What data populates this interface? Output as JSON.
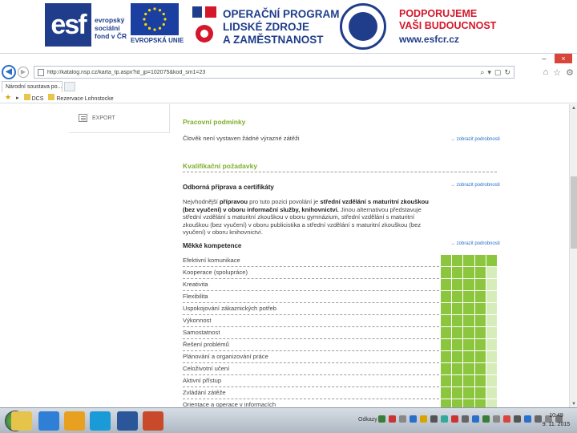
{
  "banner": {
    "esf_letters": "esf",
    "esf_text": "evropský\nsociální\nfond v ČR",
    "eu_caption": "EVROPSKÁ UNIE",
    "op_text": "OPERAČNÍ PROGRAM\nLIDSKÉ ZDROJE\nA ZAMĚSTNANOST",
    "support_text": "PODPORUJEME\nVAŠI BUDOUCNOST",
    "support_url": "www.esfcr.cz"
  },
  "browser": {
    "minimize": "–",
    "close": "×",
    "url": "http://katalog.nsp.cz/karta_tp.aspx?id_jp=102075&kod_sm1=23",
    "tab_label": "Národní soustava po...",
    "favorites": [
      "DCS",
      "Rezervace Lohnstocke"
    ]
  },
  "page": {
    "export_label": "EXPORT",
    "working_conditions": {
      "title": "Pracovní podmínky",
      "text": "Člověk není vystaven žádné výrazné zátěži",
      "link": "zobrazit podrobnosti"
    },
    "qualification_title": "Kvalifikační požadavky",
    "education": {
      "title": "Odborná příprava a certifikáty",
      "text_before": "Nejvhodnější ",
      "text_bold1": "přípravou",
      "text_mid1": " pro tuto pozici povolání je ",
      "text_bold2": "střední vzdělání s maturitní zkouškou (bez vyučení) v oboru informační služby, knihovnictví.",
      "text_after": " Jinou alternativou představuje střední vzdělání s maturitní zkouškou v oboru gymnázium, střední vzdělání s maturitní zkouškou (bez vyučení) v oboru publicistika a střední vzdělání s maturitní zkouškou (bez vyučení) v oboru knihovnictví.",
      "link": "zobrazit podrobnosti"
    },
    "soft_skills": {
      "title": "Měkké kompetence",
      "link": "zobrazit podrobnosti",
      "items": [
        {
          "name": "Efektivní komunikace",
          "level": 5
        },
        {
          "name": "Kooperace (spolupráce)",
          "level": 4
        },
        {
          "name": "Kreativita",
          "level": 4
        },
        {
          "name": "Flexibilita",
          "level": 4
        },
        {
          "name": "Uspokojování zákaznických potřeb",
          "level": 4
        },
        {
          "name": "Výkonnost",
          "level": 4
        },
        {
          "name": "Samostatnost",
          "level": 4
        },
        {
          "name": "Řešení problémů",
          "level": 4
        },
        {
          "name": "Plánování a organizování práce",
          "level": 4
        },
        {
          "name": "Celoživotní učení",
          "level": 4
        },
        {
          "name": "Aktivní přístup",
          "level": 4
        },
        {
          "name": "Zvládání zátěže",
          "level": 4
        },
        {
          "name": "Orientace a operace v informacích",
          "level": 4
        }
      ],
      "max_level": 5
    }
  },
  "taskbar": {
    "label": "Odkazy",
    "time": "10:49",
    "date": "9. 11. 2015"
  },
  "colors": {
    "accent_green": "#8cc63f",
    "light_green": "#d7ecbb",
    "title_green": "#7fae2b",
    "link_blue": "#2a6fc9",
    "esf_blue": "#1f3d8a",
    "red": "#d4172a"
  }
}
